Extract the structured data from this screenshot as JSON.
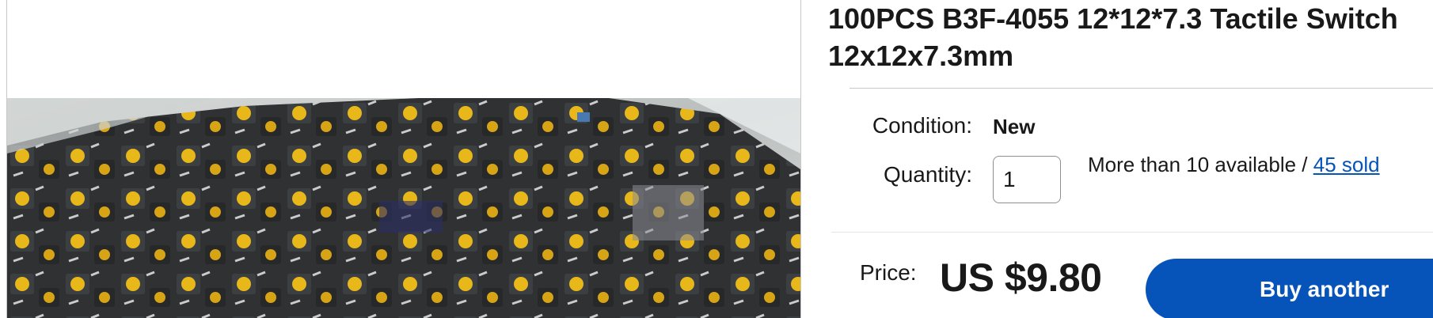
{
  "listing": {
    "title": "100PCS B3F-4055 12*12*7.3 Tactile Switch 12x12x7.3mm",
    "image_alt": "Bag of black tactile switches with yellow buttons"
  },
  "details": {
    "condition_label": "Condition:",
    "condition_value": "New",
    "quantity_label": "Quantity:",
    "quantity_value": "1",
    "availability_text": "More than 10 available / ",
    "sold_text": "45 sold"
  },
  "purchase": {
    "price_label": "Price:",
    "price_value": "US $9.80",
    "buy_button_label": "Buy another",
    "accent_color": "#0654ba"
  }
}
